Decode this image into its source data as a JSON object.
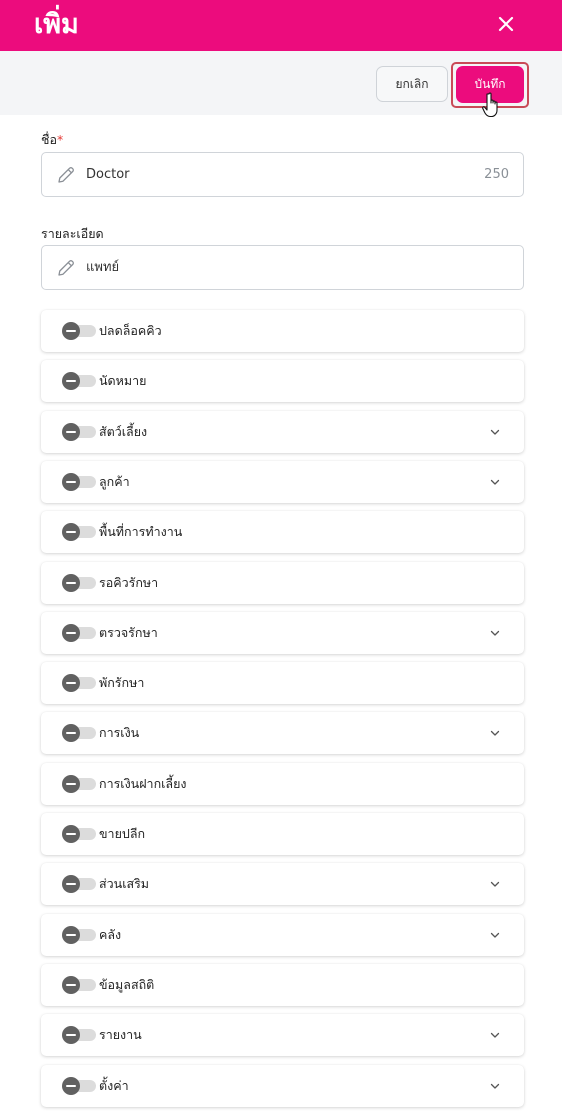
{
  "header": {
    "title": "เพิ่ม",
    "accent_color": "#ec0c7d",
    "close_icon": "close-icon"
  },
  "toolbar": {
    "cancel_label": "ยกเลิก",
    "save_label": "บันทึก"
  },
  "form": {
    "name": {
      "label": "ชื่อ",
      "required_mark": "*",
      "value": "Doctor",
      "counter": "250"
    },
    "description": {
      "label": "รายละเอียด",
      "value": "แพทย์"
    }
  },
  "permissions": [
    {
      "label": "ปลดล็อคคิว",
      "expandable": false
    },
    {
      "label": "นัดหมาย",
      "expandable": false
    },
    {
      "label": "สัตว์เลี้ยง",
      "expandable": true
    },
    {
      "label": "ลูกค้า",
      "expandable": true
    },
    {
      "label": "พื้นที่การทำงาน",
      "expandable": false
    },
    {
      "label": "รอคิวรักษา",
      "expandable": false
    },
    {
      "label": "ตรวจรักษา",
      "expandable": true
    },
    {
      "label": "พักรักษา",
      "expandable": false
    },
    {
      "label": "การเงิน",
      "expandable": true
    },
    {
      "label": "การเงินฝากเลี้ยง",
      "expandable": false
    },
    {
      "label": "ขายปลีก",
      "expandable": false
    },
    {
      "label": "ส่วนเสริม",
      "expandable": true
    },
    {
      "label": "คลัง",
      "expandable": true
    },
    {
      "label": "ข้อมูลสถิติ",
      "expandable": false
    },
    {
      "label": "รายงาน",
      "expandable": true
    },
    {
      "label": "ตั้งค่า",
      "expandable": true
    }
  ]
}
